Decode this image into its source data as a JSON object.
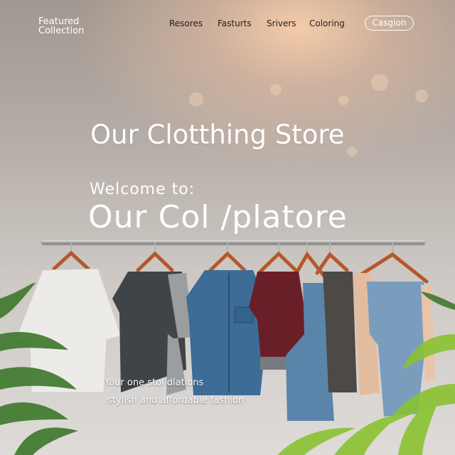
{
  "header": {
    "brand_line1": "Featured",
    "brand_line2": "Collection",
    "nav": [
      "Resores",
      "Fasturts",
      "Srivers",
      "Coloring"
    ],
    "cta_label": "Casgion"
  },
  "hero": {
    "title": "Our Clotthing Store",
    "welcome": "Welcome to:",
    "store_name": "Our Col /platore"
  },
  "tagline": {
    "line1": "Your one stol dlations",
    "line2": "stylish and affordable fashion"
  },
  "colors": {
    "accent_text": "#ffffff",
    "nav_text": "#2b221d",
    "background_warm": "#f8ceaa",
    "background_base": "#cdc8c4"
  },
  "garments": [
    {
      "name": "white-tshirt",
      "color": "#ececea"
    },
    {
      "name": "charcoal-tshirt",
      "color": "#3f4448"
    },
    {
      "name": "denim-shirt",
      "color": "#3f6f9a"
    },
    {
      "name": "burgundy-tshirt",
      "color": "#6a1f28"
    },
    {
      "name": "denim-overalls",
      "color": "#5d86ac"
    },
    {
      "name": "grey-vest",
      "color": "#4d4a48"
    },
    {
      "name": "peach-shirt",
      "color": "#e3bfa1"
    },
    {
      "name": "blue-jeans",
      "color": "#7a9dbd"
    }
  ]
}
